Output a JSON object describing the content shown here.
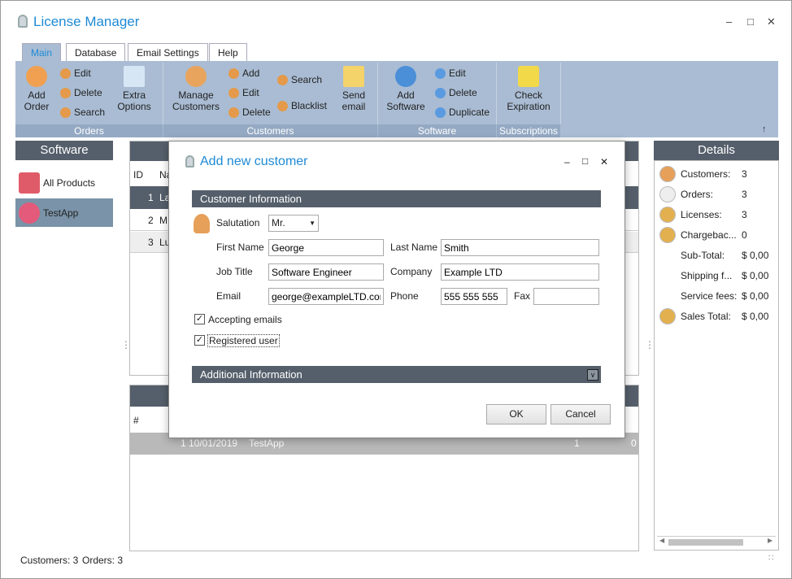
{
  "window": {
    "title": "License Manager"
  },
  "tabs": [
    {
      "label": "Main",
      "active": true
    },
    {
      "label": "Database"
    },
    {
      "label": "Email Settings"
    },
    {
      "label": "Help"
    }
  ],
  "ribbon": {
    "orders": {
      "label": "Orders",
      "add": "Add\nOrder",
      "edit": "Edit",
      "delete": "Delete",
      "search": "Search",
      "extra": "Extra\nOptions"
    },
    "customers": {
      "label": "Customers",
      "manage": "Manage\nCustomers",
      "add": "Add",
      "edit": "Edit",
      "delete": "Delete",
      "search": "Search",
      "blacklist": "Blacklist",
      "send": "Send\nemail"
    },
    "software": {
      "label": "Software",
      "add": "Add\nSoftware",
      "edit": "Edit",
      "delete": "Delete",
      "duplicate": "Duplicate"
    },
    "subscriptions": {
      "label": "Subscriptions",
      "check": "Check\nExpiration"
    }
  },
  "software_panel": {
    "title": "Software",
    "items": [
      {
        "label": "All Products"
      },
      {
        "label": "TestApp",
        "selected": true
      }
    ]
  },
  "customers_grid": {
    "columns": [
      "ID",
      "Na"
    ],
    "rows": [
      [
        "1",
        "La"
      ],
      [
        "2",
        "M"
      ],
      [
        "3",
        "Lu"
      ]
    ]
  },
  "orders_grid": {
    "columns": [
      "#"
    ],
    "rows": [
      [
        "1",
        "10/01/2019",
        "TestApp",
        "1",
        "0"
      ]
    ]
  },
  "details": {
    "title": "Details",
    "rows": [
      {
        "label": "Customers:",
        "value": "3"
      },
      {
        "label": "Orders:",
        "value": "3"
      },
      {
        "label": "Licenses:",
        "value": "3"
      },
      {
        "label": "Chargebac...",
        "value": "0"
      },
      {
        "label": "Sub-Total:",
        "value": "$ 0,00"
      },
      {
        "label": "Shipping f...",
        "value": "$ 0,00"
      },
      {
        "label": "Service fees:",
        "value": "$ 0,00"
      },
      {
        "label": "Sales Total:",
        "value": "$ 0,00"
      }
    ]
  },
  "status": {
    "customers": "Customers: 3",
    "orders": "Orders: 3"
  },
  "dialog": {
    "title": "Add new customer",
    "section1": "Customer Information",
    "section2": "Additional Information",
    "salutation_label": "Salutation",
    "salutation": "Mr.",
    "first_name_label": "First Name",
    "first_name": "George",
    "last_name_label": "Last Name",
    "last_name": "Smith",
    "job_title_label": "Job Title",
    "job_title": "Software Engineer",
    "company_label": "Company",
    "company": "Example LTD",
    "email_label": "Email",
    "email": "george@exampleLTD.com",
    "phone_label": "Phone",
    "phone": "555 555 555",
    "fax_label": "Fax",
    "fax": "",
    "accepting_emails": "Accepting emails",
    "accepting_checked": true,
    "registered_user": "Registered user",
    "registered_checked": true,
    "ok": "OK",
    "cancel": "Cancel"
  }
}
